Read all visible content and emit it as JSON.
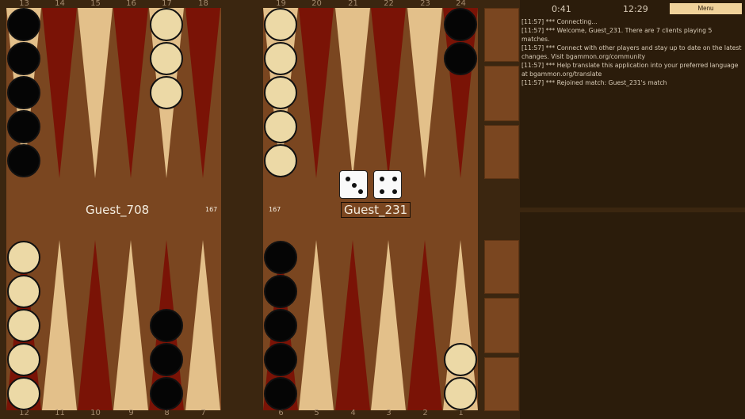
{
  "board": {
    "top_point_numbers": [
      "13",
      "14",
      "15",
      "16",
      "17",
      "18",
      "19",
      "20",
      "21",
      "22",
      "23",
      "24"
    ],
    "bottom_point_numbers": [
      "12",
      "11",
      "10",
      "9",
      "8",
      "7",
      "6",
      "5",
      "4",
      "3",
      "2",
      "1"
    ],
    "colors": {
      "light_point": "#e3c08a",
      "dark_point": "#7a1306",
      "field": "#7a4620",
      "frame": "#3b2610"
    }
  },
  "checkers": [
    {
      "point": 13,
      "color": "black",
      "count": 5
    },
    {
      "point": 17,
      "color": "white",
      "count": 3
    },
    {
      "point": 19,
      "color": "white",
      "count": 5
    },
    {
      "point": 24,
      "color": "black",
      "count": 2
    },
    {
      "point": 12,
      "color": "white",
      "count": 5
    },
    {
      "point": 8,
      "color": "black",
      "count": 3
    },
    {
      "point": 6,
      "color": "black",
      "count": 5
    },
    {
      "point": 1,
      "color": "white",
      "count": 2
    }
  ],
  "players": {
    "opponent": {
      "name": "Guest_708",
      "pips": "167"
    },
    "self": {
      "name": "Guest_231",
      "pips": "167"
    }
  },
  "dice": [
    3,
    4
  ],
  "status": {
    "timer_left": "0:41",
    "timer_right": "12:29"
  },
  "menu_label": "Menu",
  "chat_lines": [
    "[11:57] *** Connecting...",
    "[11:57] *** Welcome, Guest_231. There are 7 clients playing 5 matches.",
    "[11:57] *** Connect with other players and stay up to date on the latest changes. Visit bgammon.org/community",
    "[11:57] *** Help translate this application into your preferred language at bgammon.org/translate",
    "[11:57] *** Rejoined match: Guest_231's match"
  ],
  "chat_input": {
    "value": "",
    "placeholder": ""
  }
}
